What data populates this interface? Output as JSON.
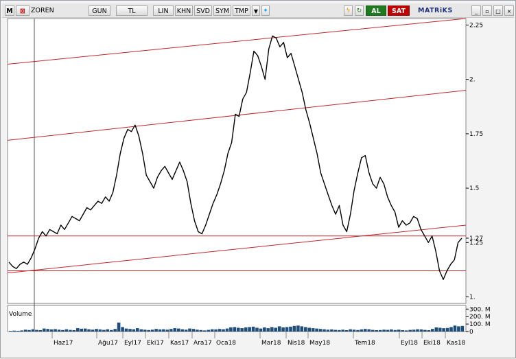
{
  "toolbar": {
    "m_label": "M",
    "symbol": "ZOREN",
    "period": "GUN",
    "currency": "TL",
    "scale": "LIN",
    "mode_khn": "KHN",
    "mode_svd": "SVD",
    "mode_sym": "SYM",
    "mode_tmp": "TMP",
    "buy_label": "AL",
    "sell_label": "SAT",
    "brand": "MATRiKS",
    "colors": {
      "buy": "#1f7a1f",
      "sell": "#c00000",
      "brand": "#20327a"
    }
  },
  "chart_data": {
    "type": "line",
    "series": [
      {
        "values": [
          1.16,
          1.14,
          1.13,
          1.15,
          1.16,
          1.15,
          1.18,
          1.22,
          1.27,
          1.3,
          1.28,
          1.31,
          1.3,
          1.29,
          1.33,
          1.31,
          1.34,
          1.37,
          1.36,
          1.35,
          1.38,
          1.41,
          1.4,
          1.42,
          1.44,
          1.43,
          1.46,
          1.44,
          1.48,
          1.56,
          1.66,
          1.73,
          1.77,
          1.76,
          1.79,
          1.74,
          1.66,
          1.56,
          1.53,
          1.5,
          1.55,
          1.58,
          1.6,
          1.57,
          1.54,
          1.58,
          1.62,
          1.58,
          1.53,
          1.43,
          1.35,
          1.3,
          1.29,
          1.33,
          1.38,
          1.43,
          1.47,
          1.52,
          1.58,
          1.66,
          1.71,
          1.84,
          1.83,
          1.91,
          1.94,
          2.03,
          2.13,
          2.11,
          2.06,
          2.0,
          2.14,
          2.2,
          2.19,
          2.15,
          2.17,
          2.1,
          2.12,
          2.06,
          2.0,
          1.94,
          1.86,
          1.8,
          1.73,
          1.66,
          1.57,
          1.52,
          1.47,
          1.42,
          1.38,
          1.42,
          1.33,
          1.3,
          1.38,
          1.49,
          1.57,
          1.64,
          1.65,
          1.57,
          1.52,
          1.5,
          1.55,
          1.52,
          1.46,
          1.42,
          1.39,
          1.32,
          1.35,
          1.33,
          1.34,
          1.37,
          1.36,
          1.31,
          1.28,
          1.25,
          1.28,
          1.21,
          1.12,
          1.08,
          1.12,
          1.15,
          1.17,
          1.25,
          1.27
        ]
      }
    ],
    "trendlines": [
      {
        "x0": 0,
        "y0": 2.07,
        "x1": 1,
        "y1": 2.28
      },
      {
        "x0": 0,
        "y0": 1.72,
        "x1": 1,
        "y1": 1.95
      },
      {
        "x0": 0,
        "y0": 1.28,
        "x1": 1,
        "y1": 1.28
      },
      {
        "x0": 0,
        "y0": 1.11,
        "x1": 1,
        "y1": 1.33
      },
      {
        "x0": 0,
        "y0": 1.12,
        "x1": 1,
        "y1": 1.12
      }
    ],
    "ylim": [
      0.97,
      2.28
    ],
    "yticks": [
      "2.25",
      "2.",
      "1.75",
      "1.5",
      "1.27",
      "1.25",
      "1."
    ],
    "xticks": [
      "Haz17",
      "Ağu17",
      "Eyl17",
      "Eki17",
      "Kas17",
      "Ara17",
      "Oca18",
      "Mar18",
      "Nis18",
      "May18",
      "Tem18",
      "Eyl18",
      "Eki18",
      "Kas18"
    ],
    "volume": {
      "label": "Volume",
      "ticks": [
        "300. M",
        "200. M",
        "100. M",
        "0"
      ],
      "ylim": [
        0,
        330
      ],
      "values": [
        8,
        12,
        10,
        15,
        25,
        20,
        30,
        22,
        18,
        40,
        35,
        28,
        32,
        25,
        20,
        30,
        22,
        18,
        45,
        38,
        40,
        30,
        25,
        35,
        28,
        22,
        30,
        20,
        35,
        120,
        60,
        40,
        35,
        30,
        45,
        30,
        25,
        20,
        25,
        35,
        28,
        30,
        25,
        35,
        45,
        40,
        30,
        25,
        40,
        35,
        25,
        20,
        15,
        22,
        30,
        28,
        35,
        30,
        40,
        55,
        60,
        50,
        45,
        55,
        60,
        65,
        50,
        40,
        55,
        45,
        60,
        50,
        70,
        55,
        60,
        65,
        75,
        80,
        70,
        60,
        50,
        45,
        40,
        35,
        30,
        25,
        28,
        22,
        20,
        25,
        18,
        30,
        25,
        20,
        28,
        35,
        30,
        22,
        18,
        20,
        25,
        22,
        28,
        20,
        25,
        18,
        15,
        22,
        25,
        30,
        28,
        22,
        18,
        35,
        55,
        50,
        45,
        48,
        60,
        80,
        70,
        75
      ]
    },
    "xlabel": "",
    "ylabel": ""
  }
}
